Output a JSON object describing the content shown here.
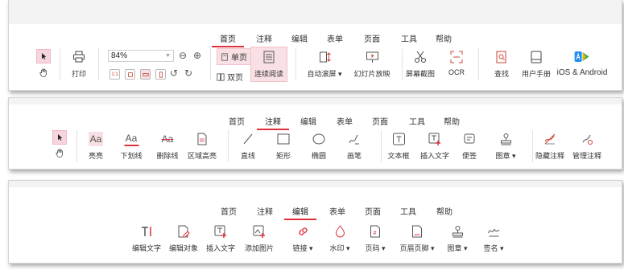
{
  "colors": {
    "accent": "#e0303c",
    "selected_bg": "#f8e0e4",
    "icon_gray": "#555555"
  },
  "tab_labels": [
    "首页",
    "注释",
    "编辑",
    "表单",
    "页面",
    "工具",
    "帮助"
  ],
  "panel1": {
    "active_tab": "首页",
    "print_label": "打印",
    "zoom_value": "84%",
    "zoom_out_symbol": "⊖",
    "zoom_in_symbol": "⊕",
    "single_page_label": "单页",
    "double_page_label": "双页",
    "continuous_label": "连续阅读",
    "tools": [
      "自动滚屏 ▾",
      "幻灯片放映",
      "屏幕截图",
      "OCR",
      "查找",
      "用户手册",
      "iOS & Android"
    ]
  },
  "panel2": {
    "active_tab": "注释",
    "tools": [
      "亮亮",
      "下划线",
      "删除线",
      "区域高亮",
      "直线",
      "矩形",
      "椭圆",
      "画笔",
      "文本框",
      "插入文字",
      "便签",
      "图章 ▾",
      "隐藏注释",
      "管理注释"
    ],
    "icon_text": {
      "highlight": "Aa",
      "underline": "Aa",
      "strike": "Aa"
    }
  },
  "panel3": {
    "active_tab": "编辑",
    "tools": [
      "编辑文字",
      "编辑对象",
      "插入文字",
      "添加图片",
      "链接 ▾",
      "水印 ▾",
      "页码 ▾",
      "页眉页脚 ▾",
      "图章 ▾",
      "签名 ▾"
    ]
  }
}
